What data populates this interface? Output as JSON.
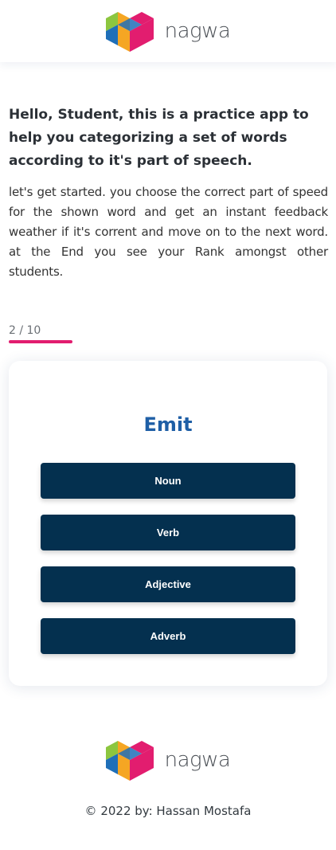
{
  "brand": {
    "name": "nagwa"
  },
  "intro": {
    "title": "Hello, Student, this is a practice app to help you categorizing a set of words according to it's part of speech.",
    "text": "let's get started. you choose the correct part of speed for the shown word and get an instant feedback weather if it's corrent and move on to the next word. at the End you see your Rank amongst other students."
  },
  "progress": {
    "label": "2 / 10",
    "current": 2,
    "total": 10,
    "fraction": 0.2,
    "color": "#e21d6f"
  },
  "question": {
    "word": "Emit",
    "options": [
      "Noun",
      "Verb",
      "Adjective",
      "Adverb"
    ]
  },
  "footer": {
    "copyright": "© 2022 by: Hassan Mostafa"
  },
  "colors": {
    "button": "#04304f",
    "word": "#1f5fa6",
    "accent": "#e21d6f"
  }
}
